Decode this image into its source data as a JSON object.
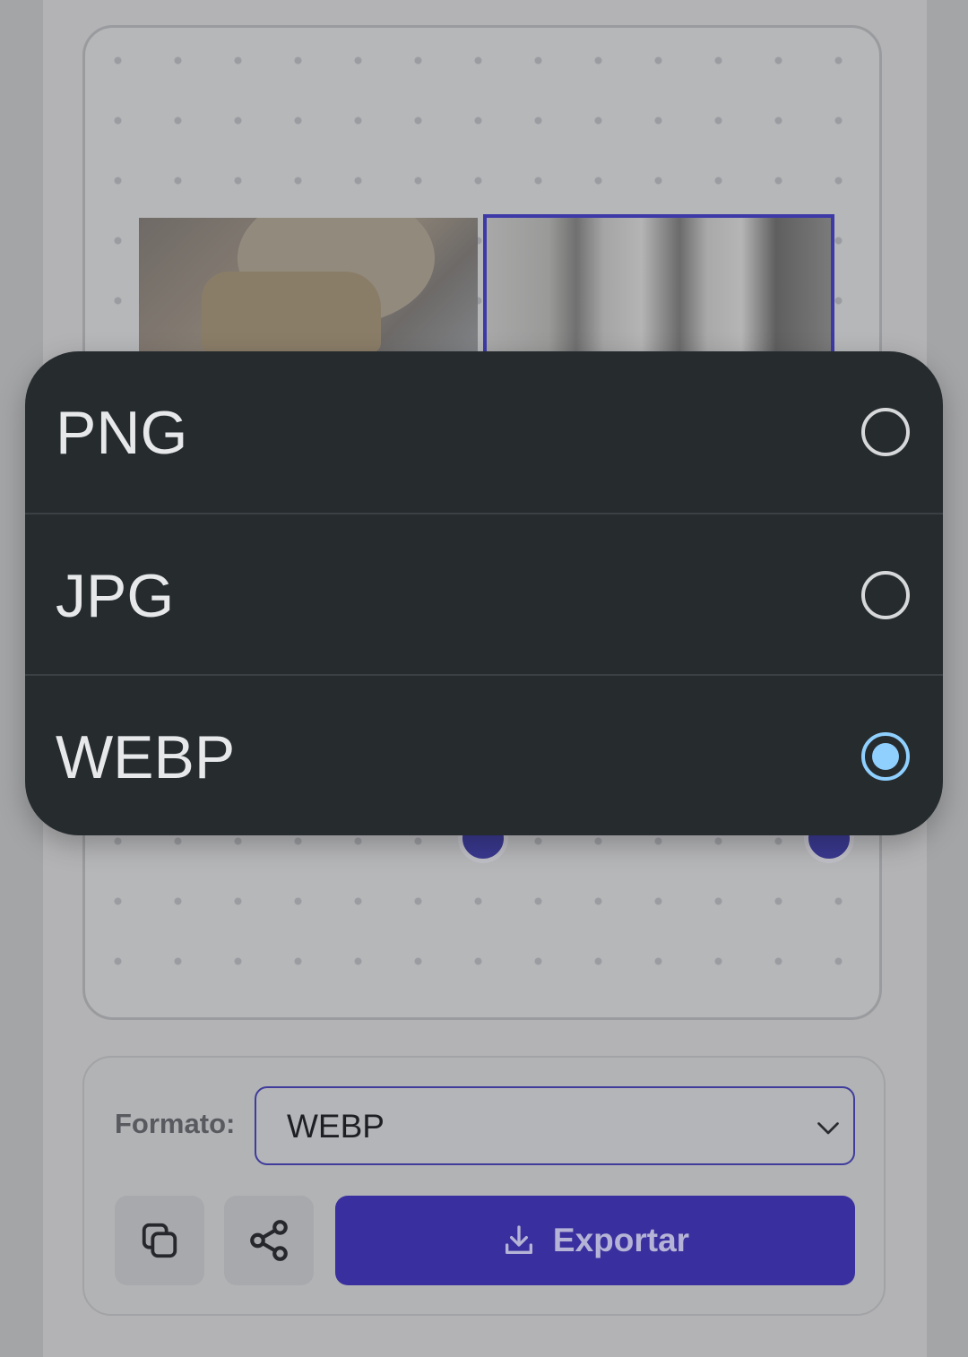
{
  "format_menu": {
    "options": [
      {
        "label": "PNG",
        "selected": false
      },
      {
        "label": "JPG",
        "selected": false
      },
      {
        "label": "WEBP",
        "selected": true
      }
    ],
    "selected_color": "#8fd0ff"
  },
  "toolbar": {
    "format_label": "Formato:",
    "format_value": "WEBP",
    "copy_icon": "copy-icon",
    "share_icon": "share-icon",
    "export_label": "Exportar",
    "export_icon": "download-icon",
    "accent_color": "#3a2f9e"
  }
}
